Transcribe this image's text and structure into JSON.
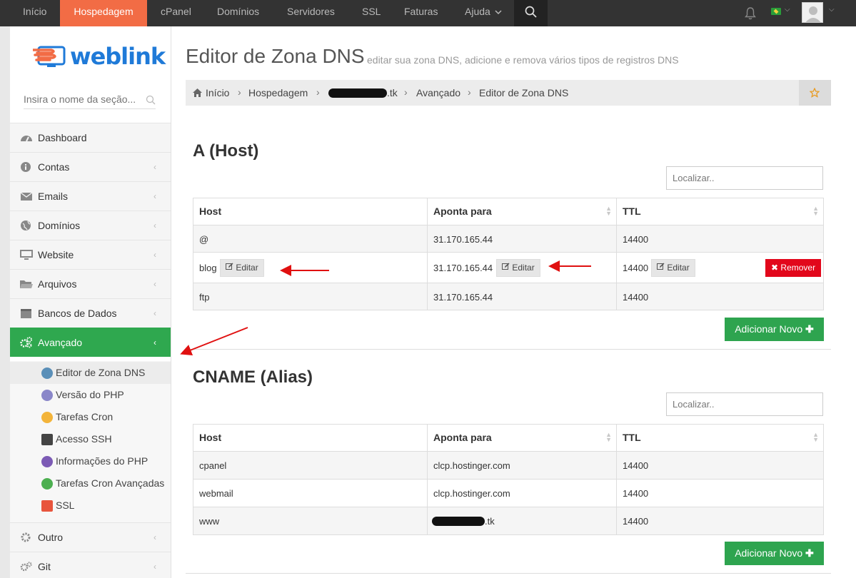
{
  "topnav": {
    "items": [
      "Início",
      "Hospedagem",
      "cPanel",
      "Domínios",
      "Servidores",
      "SSL",
      "Faturas",
      "Ajuda"
    ],
    "active": "Hospedagem"
  },
  "sidebar": {
    "logo_text": "weblink",
    "search_placeholder": "Insira o nome da seção...",
    "items": [
      {
        "label": "Dashboard",
        "icon": "dashboard-icon"
      },
      {
        "label": "Contas",
        "icon": "info-icon"
      },
      {
        "label": "Emails",
        "icon": "envelope-icon"
      },
      {
        "label": "Domínios",
        "icon": "globe-icon"
      },
      {
        "label": "Website",
        "icon": "monitor-icon"
      },
      {
        "label": "Arquivos",
        "icon": "folder-icon"
      },
      {
        "label": "Bancos de Dados",
        "icon": "database-icon"
      },
      {
        "label": "Avançado",
        "icon": "gears-icon"
      }
    ],
    "submenu": [
      {
        "label": "Editor de Zona DNS",
        "icon": "dns-icon"
      },
      {
        "label": "Versão do PHP",
        "icon": "php-icon"
      },
      {
        "label": "Tarefas Cron",
        "icon": "cron-icon"
      },
      {
        "label": "Acesso SSH",
        "icon": "ssh-icon"
      },
      {
        "label": "Informações do PHP",
        "icon": "php-info-icon"
      },
      {
        "label": "Tarefas Cron Avançadas",
        "icon": "cron-advanced-icon"
      },
      {
        "label": "SSL",
        "icon": "ssl-icon"
      }
    ],
    "bottom_items": [
      {
        "label": "Outro",
        "icon": "gear-icon"
      },
      {
        "label": "Git",
        "icon": "git-icon"
      }
    ]
  },
  "page": {
    "title": "Editor de Zona DNS",
    "subtitle": "editar sua zona DNS, adicione e remova vários tipos de registros DNS"
  },
  "breadcrumb": {
    "items": [
      "Início",
      "Hospedagem",
      ".tk",
      "Avançado",
      "Editor de Zona DNS"
    ]
  },
  "a_section": {
    "title": "A (Host)",
    "search_placeholder": "Localizar..",
    "headers": [
      "Host",
      "Aponta para",
      "TTL"
    ],
    "rows": [
      {
        "host": "@",
        "points_to": "31.170.165.44",
        "ttl": "14400"
      },
      {
        "host": "blog",
        "points_to": "31.170.165.44",
        "ttl": "14400"
      },
      {
        "host": "ftp",
        "points_to": "31.170.165.44",
        "ttl": "14400"
      }
    ],
    "edit_label": "Editar",
    "remove_label": "Remover",
    "add_label": "Adicionar Novo"
  },
  "cname_section": {
    "title": "CNAME (Alias)",
    "search_placeholder": "Localizar..",
    "headers": [
      "Host",
      "Aponta para",
      "TTL"
    ],
    "rows": [
      {
        "host": "cpanel",
        "points_to": "clcp.hostinger.com",
        "ttl": "14400"
      },
      {
        "host": "webmail",
        "points_to": "clcp.hostinger.com",
        "ttl": "14400"
      },
      {
        "host": "www",
        "points_to": ".tk",
        "ttl": "14400"
      }
    ],
    "add_label": "Adicionar Novo"
  },
  "colors": {
    "nav_bg": "#333333",
    "nav_active": "#f26c45",
    "sidebar_active": "#2fa84f",
    "add_button": "#2ea44f",
    "remove_button": "#e2071b",
    "logo_blue": "#1f7ad8",
    "logo_orange": "#f26c45",
    "annotation_arrow": "#e01010"
  }
}
